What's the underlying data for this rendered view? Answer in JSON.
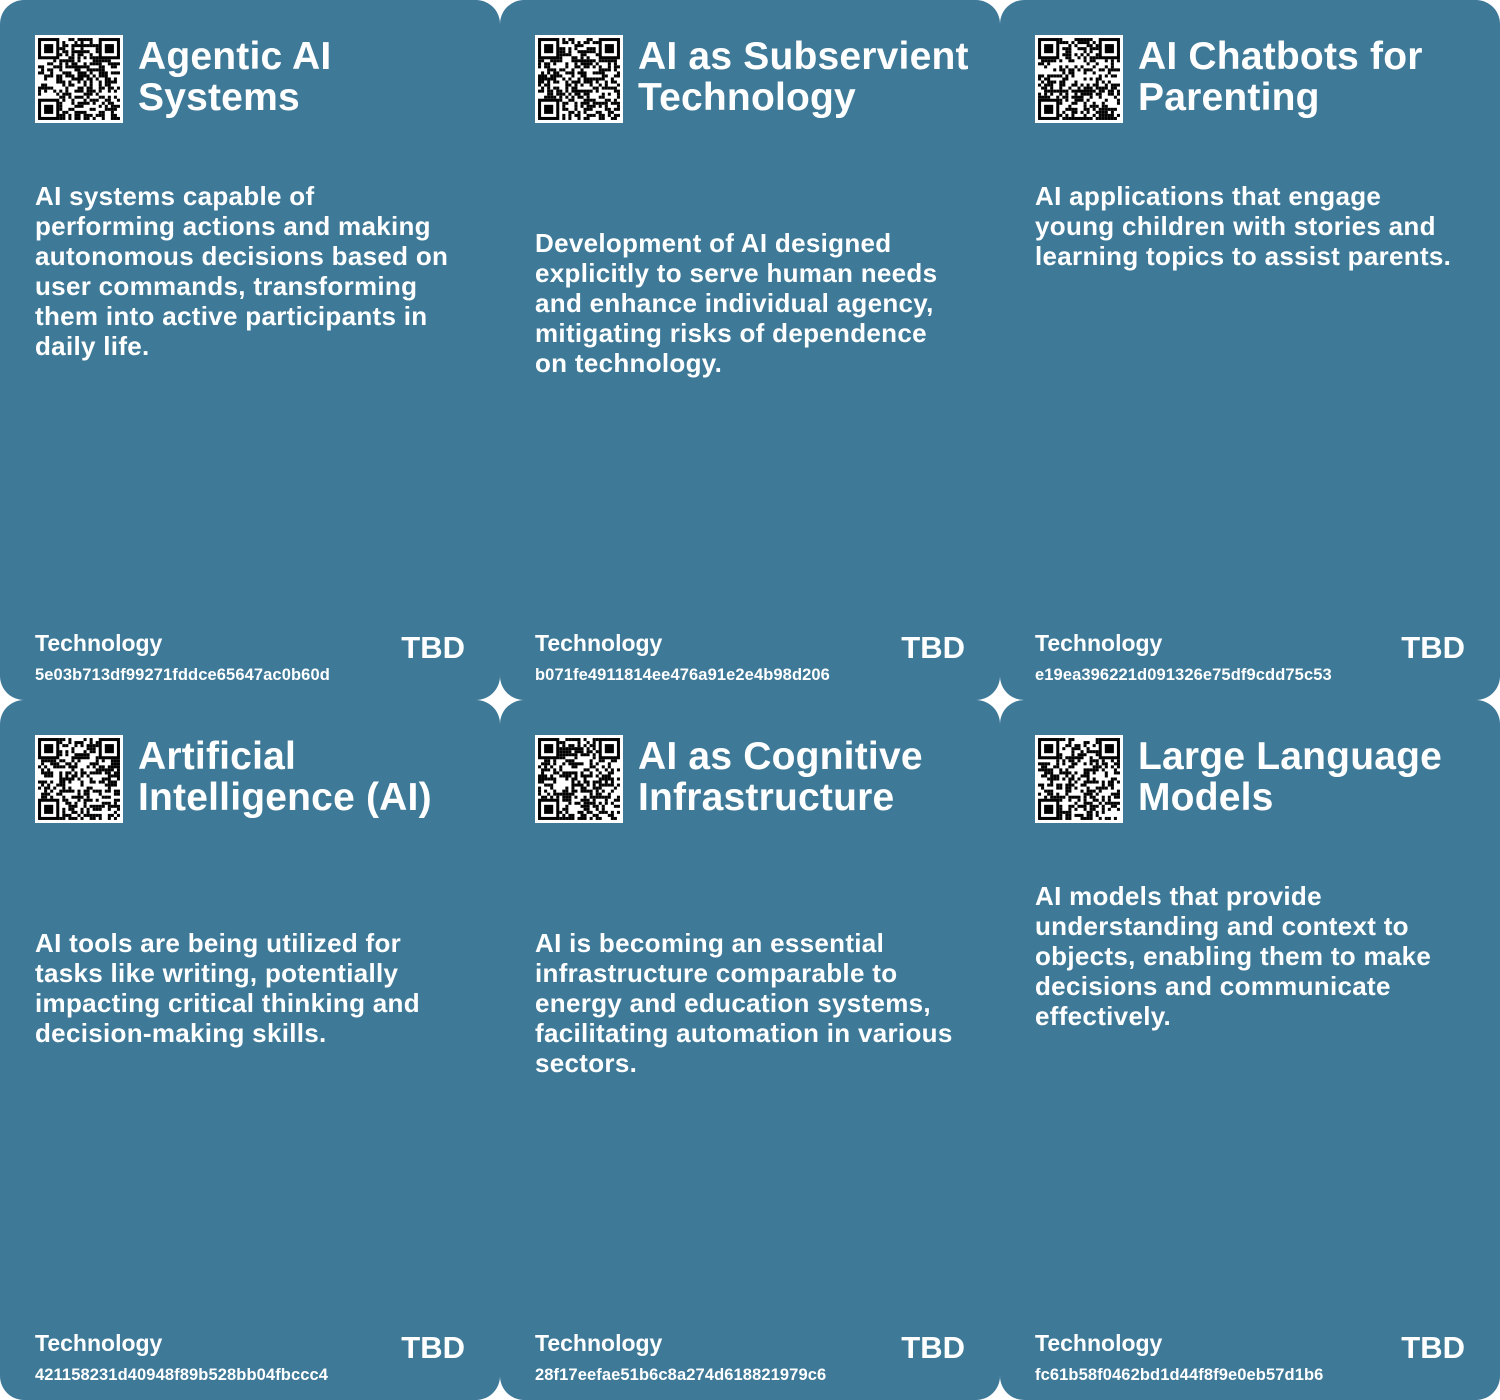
{
  "cards": [
    {
      "title": "Agentic AI Systems",
      "description": "AI systems capable of performing actions and making autonomous decisions based on user commands, transforming them into active participants in daily life.",
      "category": "Technology",
      "status": "TBD",
      "hash": "5e03b713df99271fddce65647ac0b60d"
    },
    {
      "title": "AI as Subservient Technology",
      "description": "Development of AI designed explicitly to serve human needs and enhance individual agency, mitigating risks of dependence on technology.",
      "category": "Technology",
      "status": "TBD",
      "hash": "b071fe4911814ee476a91e2e4b98d206"
    },
    {
      "title": "AI Chatbots for Parenting",
      "description": "AI applications that engage young children with stories and learning topics to assist parents.",
      "category": "Technology",
      "status": "TBD",
      "hash": "e19ea396221d091326e75df9cdd75c53"
    },
    {
      "title": "Artificial Intelligence (AI)",
      "description": "AI tools are being utilized for tasks like writing, potentially impacting critical thinking and decision-making skills.",
      "category": "Technology",
      "status": "TBD",
      "hash": "421158231d40948f89b528bb04fbccc4"
    },
    {
      "title": "AI as Cognitive Infrastructure",
      "description": "AI is becoming an essential infrastructure comparable to energy and education systems, facilitating automation in various sectors.",
      "category": "Technology",
      "status": "TBD",
      "hash": "28f17eefae51b6c8a274d618821979c6"
    },
    {
      "title": "Large Language Models",
      "description": "AI models that provide understanding and context to objects, enabling them to make decisions and communicate effectively.",
      "category": "Technology",
      "status": "TBD",
      "hash": "fc61b58f0462bd1d44f8f9e0eb57d1b6"
    }
  ]
}
